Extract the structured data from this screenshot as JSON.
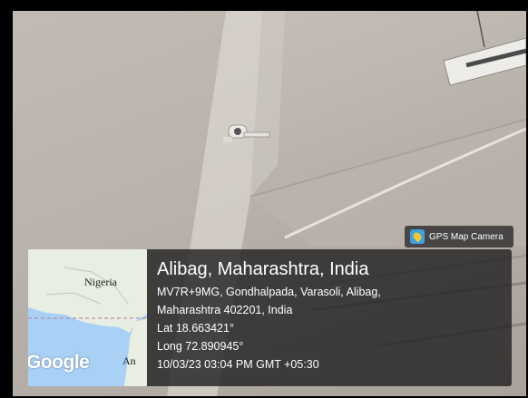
{
  "badge": {
    "label": "GPS Map Camera",
    "icon": "gps-map-camera-icon"
  },
  "map": {
    "label_nigeria": "Nigeria",
    "label_an": "An",
    "logo": "Google"
  },
  "info": {
    "title": "Alibag, Maharashtra, India",
    "address_line1": "MV7R+9MG, Gondhalpada, Varasoli, Alibag,",
    "address_line2": "Maharashtra 402201, India",
    "lat": "Lat 18.663421°",
    "long": "Long 72.890945°",
    "timestamp": "10/03/23 03:04 PM GMT +05:30"
  }
}
